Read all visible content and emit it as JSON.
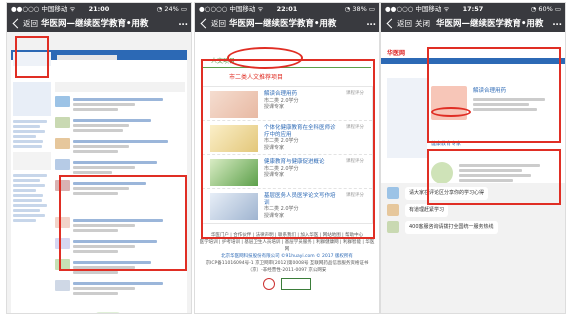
{
  "colors": {
    "highlight": "#e02e24",
    "wechat_bar": "#393a3f",
    "brand_blue": "#2c69b5",
    "green": "#5ca04a"
  },
  "screens": [
    {
      "status": {
        "carrier": "●●○○○ 中国移动 ᯤ",
        "time": "21:00",
        "battery": "◔ 24% ▭"
      },
      "nav": {
        "back": "返回",
        "title": "华医网—继续医学教育•用教",
        "more": "..."
      }
    },
    {
      "status": {
        "carrier": "●○○○○ 中国移动 ᯤ",
        "time": "22:01",
        "battery": "◔ 38% ▭"
      },
      "nav": {
        "back": "返回",
        "title": "华医网—继续医学教育•用教",
        "more": "..."
      },
      "section_label": "人文项目",
      "section_title": "市二类人文推荐项目",
      "items": [
        {
          "title": "解读合理用药",
          "meta": "市二类 2.0学分",
          "teacher": "授课专家",
          "score": "课程评分"
        },
        {
          "title": "个体化健康教育在全科医师诊疗中的应用",
          "meta": "市二类 2.0学分",
          "teacher": "授课专家",
          "score": "课程评分"
        },
        {
          "title": "健康教育与健康促进概论",
          "meta": "市二类 2.0学分",
          "teacher": "授课专家",
          "score": "课程评分"
        },
        {
          "title": "基层医务人员医学论文写作培训",
          "meta": "市二类 2.0学分",
          "teacher": "授课专家",
          "score": "课程评分"
        }
      ],
      "footer": {
        "line1": "华医门户 | 合作伙伴 | 法律声明 | 联系我们 | 加入华医 | 网站地图 | 帮助中心",
        "line2": "医学培训 | 护考培训 | 基层卫生人员培训 | 基层学员服务 | 利群健康网 | 利群智能 | 华医网",
        "line3": "北京华医网科技股份有限公司 ©91huayi.com © 2017 版权所有",
        "line4": "京ICP备11016094号-1 京卫网审[2012]第0008号 互联网药品信息服务资格证书（京）-非经营性-2011-0097 京公网安"
      }
    },
    {
      "status": {
        "carrier": "●●○○○ 中国移动 ᯤ",
        "time": "17:57",
        "battery": "◔ 60% ▭"
      },
      "nav": {
        "back": "返回",
        "close": "关闭",
        "title": "华医网—继续医学教育•用教",
        "more": "..."
      },
      "logo": "华医网",
      "course_title": "解读合理用药",
      "teacher_label": "健康教育专家",
      "chat": [
        {
          "name": "",
          "text": "请大家在评论区分享你的学习心得"
        },
        {
          "name": "",
          "text": "有道理赶紧学习"
        },
        {
          "name": "",
          "text": "400客服咨询请拨打全国统一服务热线"
        }
      ]
    }
  ]
}
